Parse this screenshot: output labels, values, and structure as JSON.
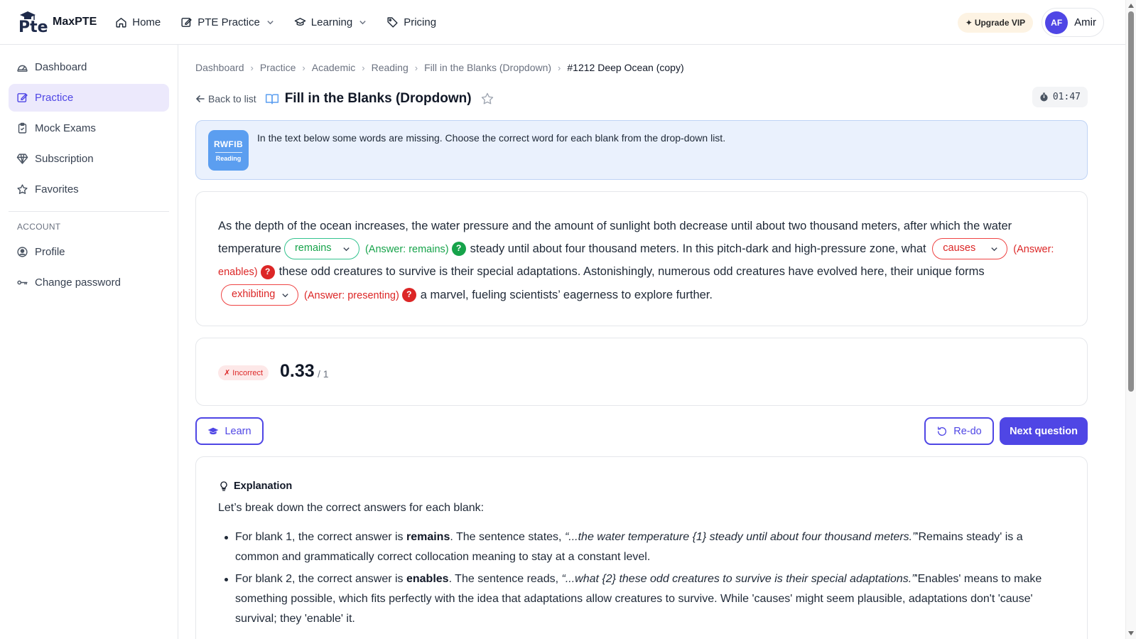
{
  "brand": {
    "name": "MaxPTE",
    "logo_text": "Pte"
  },
  "nav": [
    {
      "label": "Home",
      "icon": "home-icon"
    },
    {
      "label": "PTE Practice",
      "icon": "edit-icon",
      "dropdown": true
    },
    {
      "label": "Learning",
      "icon": "graduation-cap-icon",
      "dropdown": true
    },
    {
      "label": "Pricing",
      "icon": "tag-icon"
    }
  ],
  "header": {
    "upgrade_label": "Upgrade VIP",
    "user_initials": "AF",
    "user_name": "Amir"
  },
  "sidebar": {
    "items": [
      {
        "label": "Dashboard",
        "icon": "gauge-icon"
      },
      {
        "label": "Practice",
        "icon": "edit-icon",
        "active": true
      },
      {
        "label": "Mock Exams",
        "icon": "clipboard-icon"
      },
      {
        "label": "Subscription",
        "icon": "diamond-icon"
      },
      {
        "label": "Favorites",
        "icon": "star-icon"
      }
    ],
    "section_label": "ACCOUNT",
    "account_items": [
      {
        "label": "Profile",
        "icon": "user-circle-icon"
      },
      {
        "label": "Change password",
        "icon": "key-icon"
      }
    ]
  },
  "breadcrumb": [
    "Dashboard",
    "Practice",
    "Academic",
    "Reading",
    "Fill in the Blanks (Dropdown)",
    "#1212 Deep Ocean (copy)"
  ],
  "page": {
    "back_label": "Back to list",
    "title": "Fill in the Blanks (Dropdown)",
    "timer": "01:47"
  },
  "instruction": {
    "badge_code": "RWFIB",
    "badge_sub": "Reading",
    "text": "In the text below some words are missing. Choose the correct word for each blank from the drop-down list."
  },
  "passage": {
    "seg1": "As the depth of the ocean increases, the water pressure and the amount of sunlight both decrease until about two thousand meters, after which the water temperature",
    "seg2": "steady until about four thousand meters. In this pitch-dark and high-pressure zone, what",
    "seg3": "these odd creatures to survive is their special adaptations. Astonishingly, numerous odd creatures have evolved here, their unique forms",
    "seg4": "a marvel, fueling scientists’ eagerness to explore further.",
    "blanks": [
      {
        "selected": "remains",
        "answer_text": "(Answer: remains)",
        "correct": true
      },
      {
        "selected": "causes",
        "answer_text": "(Answer: enables)",
        "correct": false
      },
      {
        "selected": "exhibiting",
        "answer_text": "(Answer: presenting)",
        "correct": false
      }
    ],
    "qmark": "?"
  },
  "score": {
    "status": "✗ Incorrect",
    "value": "0.33",
    "max": "/ 1"
  },
  "actions": {
    "learn": "Learn",
    "redo": "Re-do",
    "next": "Next question"
  },
  "explanation": {
    "heading": "Explanation",
    "intro": "Let’s break down the correct answers for each blank:",
    "items": [
      {
        "pre": "For blank 1, the correct answer is ",
        "answer": "remains",
        "mid": ". The sentence states, ",
        "quote": "“...the water temperature {1} steady until about four thousand meters.”",
        "post": "'Remains steady' is a common and grammatically correct collocation meaning to stay at a constant level."
      },
      {
        "pre": "For blank 2, the correct answer is ",
        "answer": "enables",
        "mid": ". The sentence reads, ",
        "quote": "“...what {2} these odd creatures to survive is their special adaptations.”",
        "post": "'Enables' means to make something possible, which fits perfectly with the idea that adaptations allow creatures to survive. While 'causes' might seem plausible, adaptations don't 'cause' survival; they 'enable' it."
      }
    ]
  },
  "colors": {
    "accent": "#4f46e5",
    "correct": "#16a34a",
    "incorrect": "#dc2626",
    "instruction_bg": "#eaf1fd"
  }
}
